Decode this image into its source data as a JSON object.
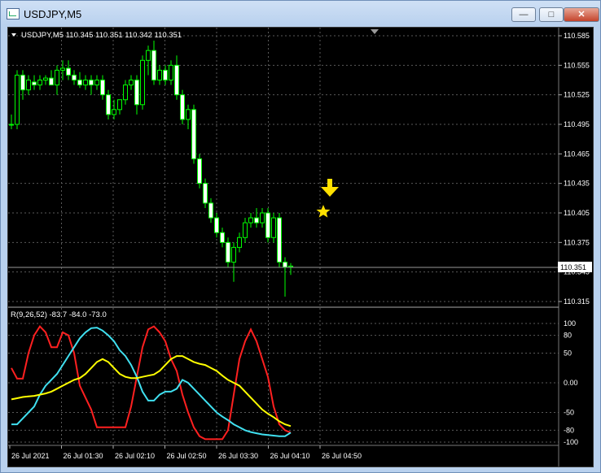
{
  "window": {
    "title": "USDJPY,M5",
    "minimize_label": "—",
    "maximize_label": "□",
    "close_label": "✕"
  },
  "colors": {
    "background": "#000000",
    "grid": "#5a5a5a",
    "bull": "#00ff00",
    "bear_body": "#ffffff",
    "red_line": "#ff2020",
    "cyan_line": "#40e0f0",
    "yellow_line": "#ffff00",
    "marker": "#ffe000"
  },
  "price_panel": {
    "label": "USDJPY,M5  110.345 110.351 110.342 110.351",
    "current_price": "110.351",
    "ticks": [
      "110.585",
      "110.555",
      "110.525",
      "110.495",
      "110.465",
      "110.435",
      "110.405",
      "110.375",
      "110.345",
      "110.315"
    ]
  },
  "indicator_panel": {
    "label": "R(9,26,52) -83.7 -84.0 -73.0",
    "ticks": [
      "100",
      "80",
      "50",
      "0.00",
      "-50",
      "-80",
      "-100"
    ]
  },
  "time_axis": [
    "26 Jul 2021",
    "26 Jul 01:30",
    "26 Jul 02:10",
    "26 Jul 02:50",
    "26 Jul 03:30",
    "26 Jul 04:10",
    "26 Jul 04:50"
  ],
  "chart_data": {
    "type": "candlestick",
    "price_ylim": [
      110.31,
      110.59
    ],
    "candles": [
      [
        110.495,
        110.505,
        110.49,
        110.495
      ],
      [
        110.495,
        110.55,
        110.49,
        110.545
      ],
      [
        110.545,
        110.55,
        110.52,
        110.53
      ],
      [
        110.53,
        110.545,
        110.525,
        110.54
      ],
      [
        110.538,
        110.545,
        110.53,
        110.535
      ],
      [
        110.535,
        110.545,
        110.53,
        110.54
      ],
      [
        110.54,
        110.545,
        110.535,
        110.542
      ],
      [
        110.542,
        110.55,
        110.535,
        110.535
      ],
      [
        110.535,
        110.555,
        110.525,
        110.55
      ],
      [
        110.55,
        110.56,
        110.54,
        110.552
      ],
      [
        110.552,
        110.56,
        110.54,
        110.545
      ],
      [
        110.545,
        110.55,
        110.535,
        110.54
      ],
      [
        110.54,
        110.548,
        110.532,
        110.535
      ],
      [
        110.535,
        110.545,
        110.53,
        110.54
      ],
      [
        110.54,
        110.545,
        110.525,
        110.535
      ],
      [
        110.535,
        110.545,
        110.53,
        110.54
      ],
      [
        110.54,
        110.545,
        110.52,
        110.525
      ],
      [
        110.525,
        110.53,
        110.5,
        110.505
      ],
      [
        110.505,
        110.52,
        110.5,
        110.51
      ],
      [
        110.51,
        110.52,
        110.505,
        110.52
      ],
      [
        110.52,
        110.54,
        110.515,
        110.535
      ],
      [
        110.535,
        110.545,
        110.53,
        110.54
      ],
      [
        110.54,
        110.545,
        110.505,
        110.515
      ],
      [
        110.515,
        110.565,
        110.51,
        110.56
      ],
      [
        110.56,
        110.575,
        110.545,
        110.57
      ],
      [
        110.57,
        110.58,
        110.535,
        110.54
      ],
      [
        110.54,
        110.555,
        110.535,
        110.55
      ],
      [
        110.55,
        110.555,
        110.535,
        110.54
      ],
      [
        110.54,
        110.56,
        110.535,
        110.555
      ],
      [
        110.555,
        110.565,
        110.52,
        110.525
      ],
      [
        110.525,
        110.53,
        110.495,
        110.5
      ],
      [
        110.5,
        110.515,
        110.49,
        110.51
      ],
      [
        110.51,
        110.515,
        110.455,
        110.46
      ],
      [
        110.46,
        110.465,
        110.43,
        110.435
      ],
      [
        110.435,
        110.44,
        110.41,
        110.415
      ],
      [
        110.415,
        110.42,
        110.395,
        110.4
      ],
      [
        110.4,
        110.405,
        110.38,
        110.385
      ],
      [
        110.385,
        110.39,
        110.37,
        110.375
      ],
      [
        110.375,
        110.38,
        110.35,
        110.355
      ],
      [
        110.355,
        110.375,
        110.335,
        110.37
      ],
      [
        110.37,
        110.385,
        110.365,
        110.38
      ],
      [
        110.38,
        110.4,
        110.375,
        110.395
      ],
      [
        110.395,
        110.405,
        110.39,
        110.4
      ],
      [
        110.4,
        110.41,
        110.39,
        110.395
      ],
      [
        110.395,
        110.41,
        110.39,
        110.405
      ],
      [
        110.405,
        110.41,
        110.375,
        110.38
      ],
      [
        110.38,
        110.405,
        110.375,
        110.4
      ],
      [
        110.4,
        110.405,
        110.35,
        110.355
      ],
      [
        110.355,
        110.36,
        110.32,
        110.35
      ],
      [
        110.35,
        110.354,
        110.342,
        110.351
      ]
    ],
    "oscillator_ylim": [
      -110,
      110
    ],
    "series": [
      {
        "values": [
          25,
          7,
          7,
          50,
          80,
          95,
          85,
          60,
          60,
          85,
          80,
          50,
          -5,
          -25,
          -45,
          -75,
          -75,
          -75,
          -75,
          -75,
          -75,
          -40,
          10,
          60,
          90,
          95,
          85,
          70,
          40,
          20,
          -20,
          -50,
          -75,
          -90,
          -95,
          -95,
          -95,
          -95,
          -80,
          -20,
          40,
          70,
          90,
          70,
          40,
          10,
          -40,
          -70,
          -80,
          -84
        ]
      },
      {
        "values": [
          -70,
          -70,
          -60,
          -50,
          -40,
          -20,
          -5,
          5,
          15,
          30,
          45,
          60,
          75,
          85,
          92,
          93,
          88,
          80,
          70,
          55,
          45,
          30,
          10,
          -15,
          -30,
          -30,
          -20,
          -15,
          -15,
          -10,
          5,
          0,
          -10,
          -20,
          -30,
          -40,
          -50,
          -57,
          -63,
          -70,
          -75,
          -80,
          -83,
          -85,
          -87,
          -88,
          -89,
          -90,
          -90,
          -84
        ]
      },
      {
        "values": [
          -28,
          -26,
          -24,
          -23,
          -22,
          -20,
          -18,
          -15,
          -10,
          -5,
          0,
          5,
          8,
          15,
          25,
          35,
          40,
          35,
          25,
          15,
          10,
          8,
          8,
          10,
          12,
          14,
          20,
          30,
          40,
          45,
          45,
          40,
          35,
          32,
          30,
          25,
          20,
          12,
          5,
          0,
          -5,
          -15,
          -25,
          -35,
          -45,
          -52,
          -58,
          -65,
          -70,
          -73
        ]
      }
    ]
  }
}
